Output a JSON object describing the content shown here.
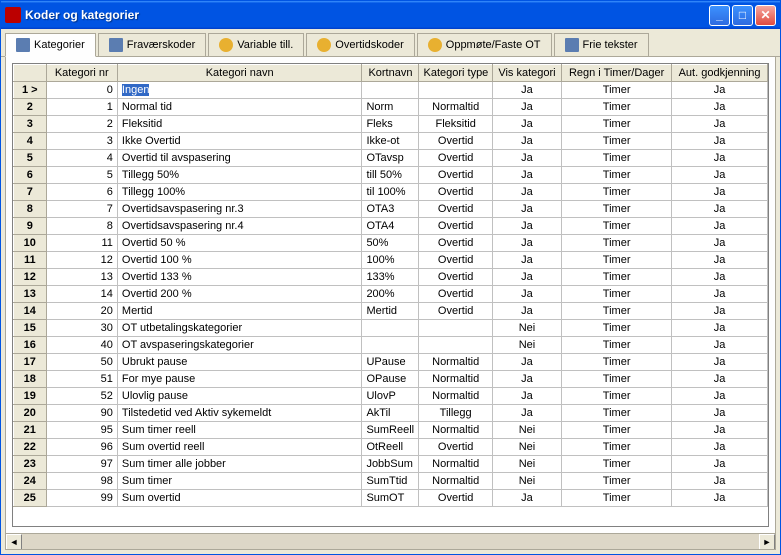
{
  "window": {
    "title": "Koder og kategorier"
  },
  "tabs": [
    {
      "label": "Kategorier",
      "active": true
    },
    {
      "label": "Fraværskoder",
      "active": false
    },
    {
      "label": "Variable till.",
      "active": false
    },
    {
      "label": "Overtidskoder",
      "active": false
    },
    {
      "label": "Oppmøte/Faste OT",
      "active": false
    },
    {
      "label": "Frie tekster",
      "active": false
    }
  ],
  "columns": [
    "Kategori nr",
    "Kategori navn",
    "Kortnavn",
    "Kategori type",
    "Vis kategori",
    "Regn i Timer/Dager",
    "Aut. godkjenning"
  ],
  "rows": [
    {
      "row": "1 >",
      "nr": "0",
      "name": "Ingen",
      "short": "",
      "type": "",
      "vis": "Ja",
      "regn": "Timer",
      "aut": "Ja",
      "selected": true
    },
    {
      "row": "2",
      "nr": "1",
      "name": "Normal tid",
      "short": "Norm",
      "type": "Normaltid",
      "vis": "Ja",
      "regn": "Timer",
      "aut": "Ja"
    },
    {
      "row": "3",
      "nr": "2",
      "name": "Fleksitid",
      "short": "Fleks",
      "type": "Fleksitid",
      "vis": "Ja",
      "regn": "Timer",
      "aut": "Ja"
    },
    {
      "row": "4",
      "nr": "3",
      "name": "Ikke Overtid",
      "short": "Ikke-ot",
      "type": "Overtid",
      "vis": "Ja",
      "regn": "Timer",
      "aut": "Ja"
    },
    {
      "row": "5",
      "nr": "4",
      "name": "Overtid til avspasering",
      "short": "OTavsp",
      "type": "Overtid",
      "vis": "Ja",
      "regn": "Timer",
      "aut": "Ja"
    },
    {
      "row": "6",
      "nr": "5",
      "name": "Tillegg 50%",
      "short": "till 50%",
      "type": "Overtid",
      "vis": "Ja",
      "regn": "Timer",
      "aut": "Ja"
    },
    {
      "row": "7",
      "nr": "6",
      "name": "Tillegg 100%",
      "short": "til 100%",
      "type": "Overtid",
      "vis": "Ja",
      "regn": "Timer",
      "aut": "Ja"
    },
    {
      "row": "8",
      "nr": "7",
      "name": "Overtidsavspasering nr.3",
      "short": "OTA3",
      "type": "Overtid",
      "vis": "Ja",
      "regn": "Timer",
      "aut": "Ja"
    },
    {
      "row": "9",
      "nr": "8",
      "name": "Overtidsavspasering nr.4",
      "short": "OTA4",
      "type": "Overtid",
      "vis": "Ja",
      "regn": "Timer",
      "aut": "Ja"
    },
    {
      "row": "10",
      "nr": "11",
      "name": "Overtid 50 %",
      "short": "50%",
      "type": "Overtid",
      "vis": "Ja",
      "regn": "Timer",
      "aut": "Ja"
    },
    {
      "row": "11",
      "nr": "12",
      "name": "Overtid 100 %",
      "short": "100%",
      "type": "Overtid",
      "vis": "Ja",
      "regn": "Timer",
      "aut": "Ja"
    },
    {
      "row": "12",
      "nr": "13",
      "name": "Overtid 133 %",
      "short": "133%",
      "type": "Overtid",
      "vis": "Ja",
      "regn": "Timer",
      "aut": "Ja"
    },
    {
      "row": "13",
      "nr": "14",
      "name": "Overtid 200 %",
      "short": "200%",
      "type": "Overtid",
      "vis": "Ja",
      "regn": "Timer",
      "aut": "Ja"
    },
    {
      "row": "14",
      "nr": "20",
      "name": "Mertid",
      "short": "Mertid",
      "type": "Overtid",
      "vis": "Ja",
      "regn": "Timer",
      "aut": "Ja"
    },
    {
      "row": "15",
      "nr": "30",
      "name": "OT utbetalingskategorier",
      "short": "",
      "type": "",
      "vis": "Nei",
      "regn": "Timer",
      "aut": "Ja"
    },
    {
      "row": "16",
      "nr": "40",
      "name": "OT avspaseringskategorier",
      "short": "",
      "type": "",
      "vis": "Nei",
      "regn": "Timer",
      "aut": "Ja"
    },
    {
      "row": "17",
      "nr": "50",
      "name": "Ubrukt pause",
      "short": "UPause",
      "type": "Normaltid",
      "vis": "Ja",
      "regn": "Timer",
      "aut": "Ja"
    },
    {
      "row": "18",
      "nr": "51",
      "name": "For mye pause",
      "short": "OPause",
      "type": "Normaltid",
      "vis": "Ja",
      "regn": "Timer",
      "aut": "Ja"
    },
    {
      "row": "19",
      "nr": "52",
      "name": "Ulovlig pause",
      "short": "UlovP",
      "type": "Normaltid",
      "vis": "Ja",
      "regn": "Timer",
      "aut": "Ja"
    },
    {
      "row": "20",
      "nr": "90",
      "name": "Tilstedetid ved Aktiv sykemeldt",
      "short": "AkTil",
      "type": "Tillegg",
      "vis": "Ja",
      "regn": "Timer",
      "aut": "Ja"
    },
    {
      "row": "21",
      "nr": "95",
      "name": "Sum timer reell",
      "short": "SumReell",
      "type": "Normaltid",
      "vis": "Nei",
      "regn": "Timer",
      "aut": "Ja"
    },
    {
      "row": "22",
      "nr": "96",
      "name": "Sum overtid reell",
      "short": "OtReell",
      "type": "Overtid",
      "vis": "Nei",
      "regn": "Timer",
      "aut": "Ja"
    },
    {
      "row": "23",
      "nr": "97",
      "name": "Sum timer alle jobber",
      "short": "JobbSum",
      "type": "Normaltid",
      "vis": "Nei",
      "regn": "Timer",
      "aut": "Ja"
    },
    {
      "row": "24",
      "nr": "98",
      "name": "Sum timer",
      "short": "SumTtid",
      "type": "Normaltid",
      "vis": "Nei",
      "regn": "Timer",
      "aut": "Ja"
    },
    {
      "row": "25",
      "nr": "99",
      "name": "Sum overtid",
      "short": "SumOT",
      "type": "Overtid",
      "vis": "Ja",
      "regn": "Timer",
      "aut": "Ja"
    }
  ]
}
